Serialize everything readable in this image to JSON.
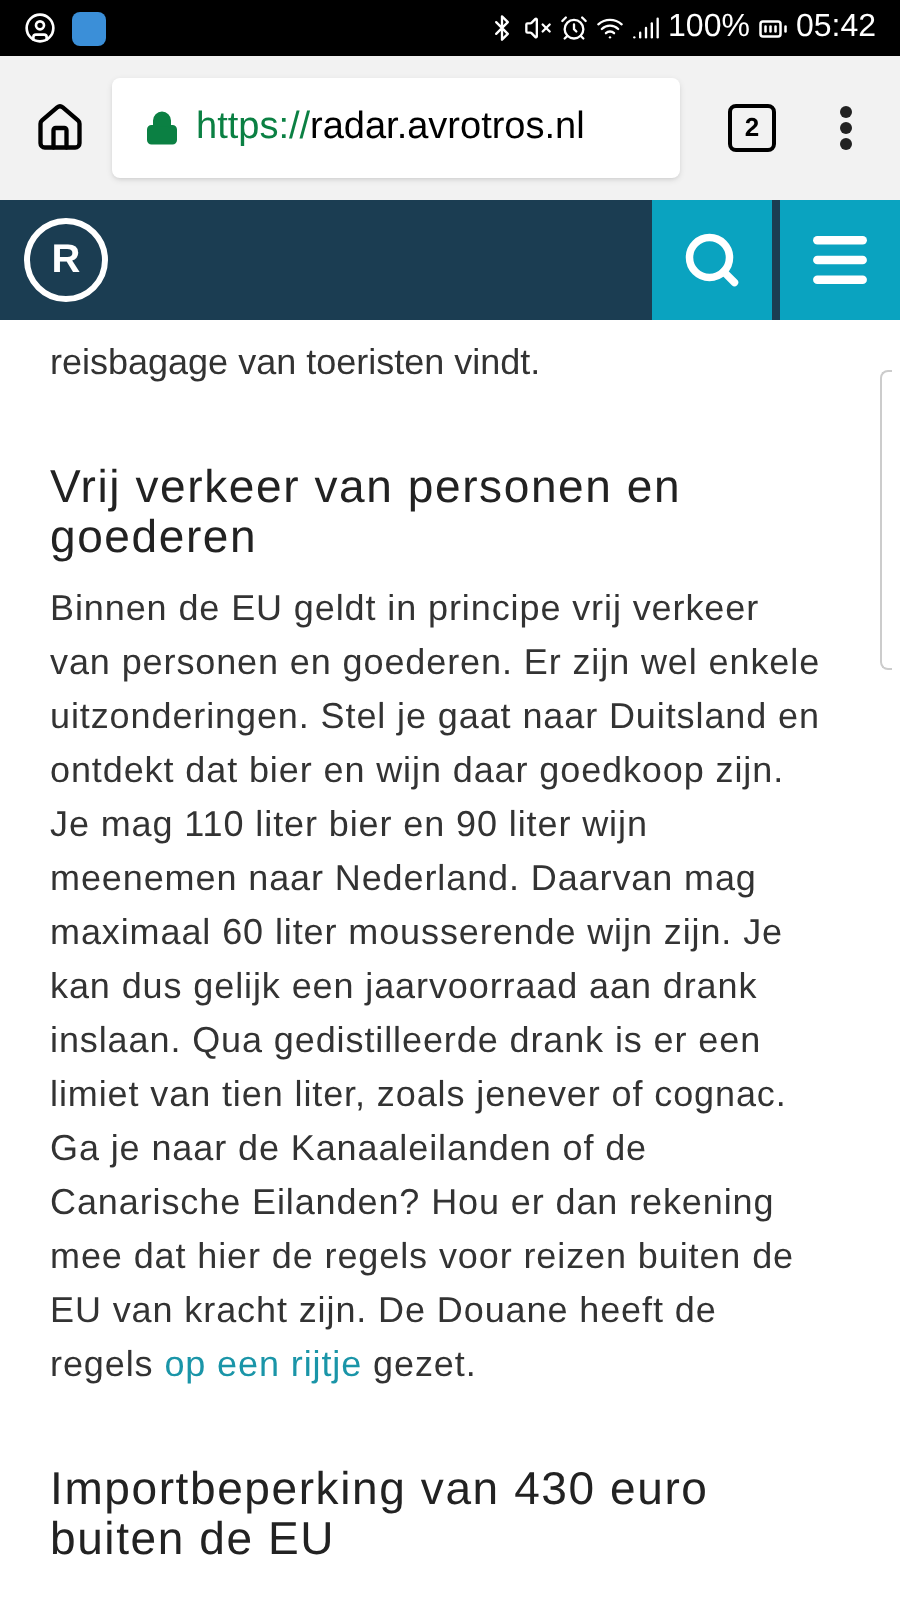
{
  "status_bar": {
    "battery": "100%",
    "time": "05:42"
  },
  "browser": {
    "url_scheme": "https://",
    "url_host": "radar.avrotros.nl",
    "tab_count": "2"
  },
  "site_header": {
    "logo_letter": "R"
  },
  "article": {
    "intro_tail": "reisbagage van toeristen vindt.",
    "sections": [
      {
        "heading": "Vrij verkeer van personen en goederen",
        "text_before": "Binnen de EU geldt in principe vrij verkeer van personen en goederen. Er zijn wel enkele uitzonderingen. Stel je gaat naar Duitsland en ontdekt dat bier en wijn daar goedkoop zijn. Je mag 110 liter bier en 90 liter wijn meenemen naar Nederland. Daarvan mag maximaal 60 liter mousserende wijn zijn. Je kan dus gelijk een jaarvoorraad aan drank inslaan. Qua gedistilleerde drank is er een limiet van tien liter, zoals jenever of cognac. Ga je naar de Kanaaleilanden of de Canarische Eilanden? Hou er dan rekening mee dat hier de regels voor reizen buiten de EU van kracht zijn. De Douane heeft de regels ",
        "link": "op een rijtje",
        "text_after": " gezet."
      },
      {
        "heading": "Importbeperking van 430 euro buiten de EU"
      }
    ]
  }
}
